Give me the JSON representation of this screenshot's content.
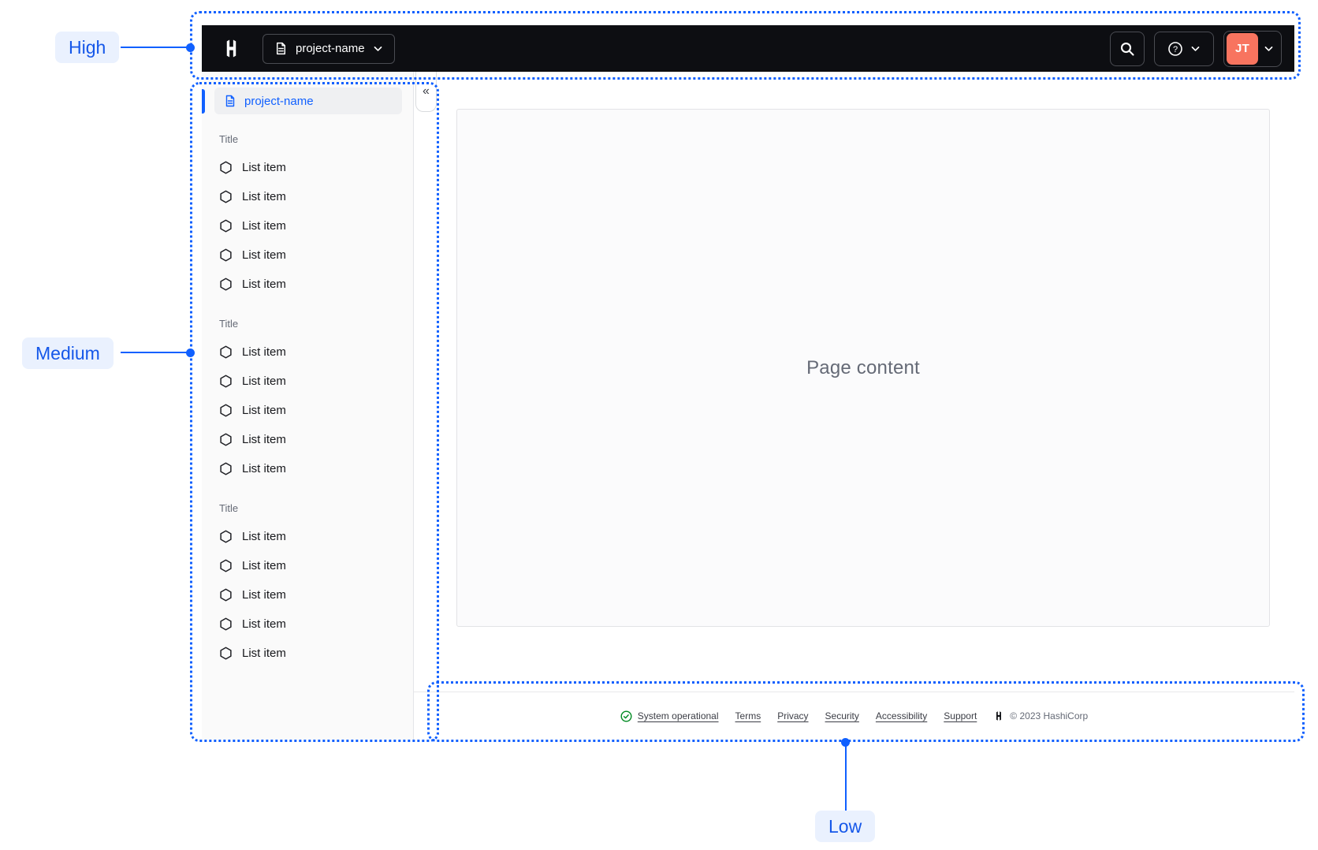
{
  "annotations": {
    "high": {
      "label": "High"
    },
    "medium": {
      "label": "Medium"
    },
    "low": {
      "label": "Low"
    }
  },
  "navbar": {
    "project_switcher_label": "project-name",
    "user_initials": "JT"
  },
  "sidebar": {
    "active_item_label": "project-name",
    "collapse_glyph": "«",
    "sections": [
      {
        "title": "Title",
        "items": [
          "List item",
          "List item",
          "List item",
          "List item",
          "List item"
        ]
      },
      {
        "title": "Title",
        "items": [
          "List item",
          "List item",
          "List item",
          "List item",
          "List item"
        ]
      },
      {
        "title": "Title",
        "items": [
          "List item",
          "List item",
          "List item",
          "List item",
          "List item"
        ]
      }
    ]
  },
  "main": {
    "placeholder": "Page content"
  },
  "footer": {
    "status_label": "System operational",
    "links": [
      "Terms",
      "Privacy",
      "Security",
      "Accessibility",
      "Support"
    ],
    "copyright": "© 2023 HashiCorp"
  },
  "colors": {
    "annotation_blue": "#1060FF",
    "navbar_black": "#0D0E12",
    "avatar_orange": "#F8745F",
    "status_green": "#008A22"
  }
}
